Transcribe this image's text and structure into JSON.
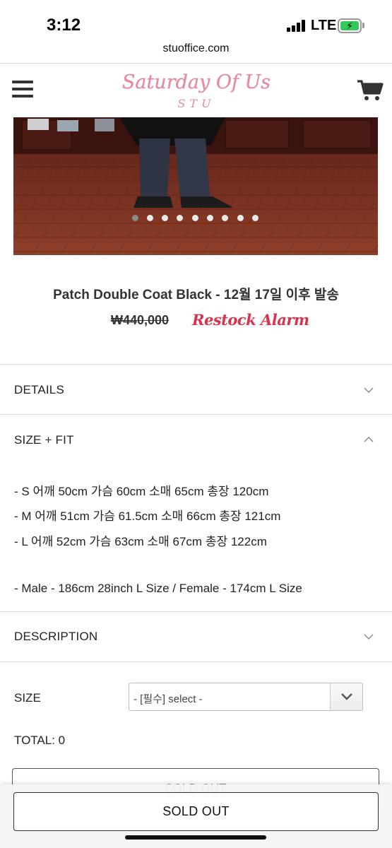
{
  "status_bar": {
    "time": "3:12",
    "network": "LTE"
  },
  "browser": {
    "url": "stuoffice.com"
  },
  "header": {
    "logo_text": "Saturday Of Us",
    "logo_sub": "STU"
  },
  "product": {
    "title": "Patch Double Coat Black - 12월 17일 이후 발송",
    "price": "₩440,000",
    "restock_label": "Restock Alarm",
    "image_count": 9,
    "active_image": 1
  },
  "details": {
    "title": "DETAILS"
  },
  "size_fit": {
    "title": "SIZE + FIT",
    "lines": [
      "- S 어깨 50cm 가슴 60cm 소매 65cm 총장 120cm",
      "- M 어깨 51cm 가슴 61.5cm 소매 66cm 총장 121cm",
      "- L 어깨 52cm 가슴 63cm 소매 67cm 총장 122cm",
      "- Male - 186cm 28inch L Size / Female - 174cm L Size"
    ]
  },
  "description": {
    "title": "DESCRIPTION"
  },
  "options": {
    "size_label": "SIZE",
    "select_value": "- [필수] select -",
    "total": "TOTAL: 0"
  },
  "buttons": {
    "sold_out_hidden": "SOLD OUT",
    "sold_out": "SOLD OUT"
  }
}
